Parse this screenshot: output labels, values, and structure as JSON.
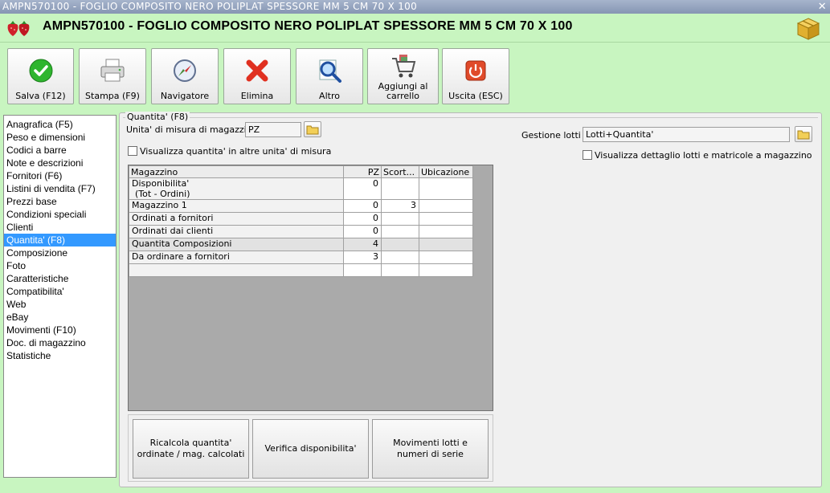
{
  "window": {
    "titlebar": "AMPN570100 - FOGLIO COMPOSITO NERO POLIPLAT SPESSORE MM 5 CM 70 X 100",
    "title": "AMPN570100 - FOGLIO COMPOSITO NERO POLIPLAT SPESSORE MM 5 CM 70 X 100",
    "close_glyph": "✕"
  },
  "toolbar": {
    "save": "Salva (F12)",
    "print": "Stampa (F9)",
    "navigator": "Navigatore",
    "delete": "Elimina",
    "other": "Altro",
    "add_cart": "Aggiungi al carrello",
    "exit": "Uscita (ESC)"
  },
  "icons": {
    "save": "check-icon",
    "print": "printer-icon",
    "navigator": "compass-icon",
    "delete": "x-icon",
    "other": "magnifier-icon",
    "add_cart": "cart-icon",
    "exit": "power-icon"
  },
  "sidebar": {
    "items": [
      "Anagrafica (F5)",
      "Peso e dimensioni",
      "Codici a barre",
      "Note e descrizioni",
      "Fornitori (F6)",
      "Listini di vendita (F7)",
      "Prezzi base",
      "Condizioni speciali",
      "Clienti",
      "Quantita' (F8)",
      "Composizione",
      "Foto",
      "Caratteristiche",
      "Compatibilita'",
      "Web",
      "eBay",
      "Movimenti (F10)",
      "Doc. di magazzino",
      "Statistiche"
    ],
    "selected_index": 9
  },
  "panel": {
    "legend": "Quantita' (F8)",
    "uom_label": "Unita' di misura di magazzino :",
    "uom_value": "PZ",
    "show_other_units": "Visualizza quantita' in altre unita' di misura",
    "lots_label": "Gestione lotti :",
    "lots_value": "Lotti+Quantita'",
    "show_lot_detail": "Visualizza dettaglio lotti e matricole a magazzino"
  },
  "grid": {
    "headers": [
      "Magazzino",
      "PZ",
      "Scort...",
      "Ubicazione"
    ],
    "rows": [
      {
        "name": "Disponibilita'",
        "name2": "(Tot - Ordini)",
        "pz": "0",
        "scorta": "",
        "ubicazione": ""
      },
      {
        "name": "Magazzino 1",
        "pz": "0",
        "scorta": "3",
        "ubicazione": ""
      },
      {
        "name": "Ordinati a fornitori",
        "pz": "0",
        "scorta": "",
        "ubicazione": ""
      },
      {
        "name": "Ordinati dai clienti",
        "pz": "0",
        "scorta": "",
        "ubicazione": ""
      },
      {
        "name": "Quantita Composizioni",
        "pz": "4",
        "scorta": "",
        "ubicazione": ""
      },
      {
        "name": "Da ordinare a fornitori",
        "pz": "3",
        "scorta": "",
        "ubicazione": ""
      },
      {
        "name": "",
        "pz": "",
        "scorta": "",
        "ubicazione": ""
      }
    ]
  },
  "bottom_buttons": {
    "recalc": "Ricalcola quantita' ordinate / mag. calcolati",
    "verify": "Verifica disponibilita'",
    "lot_moves": "Movimenti lotti e numeri di serie"
  }
}
